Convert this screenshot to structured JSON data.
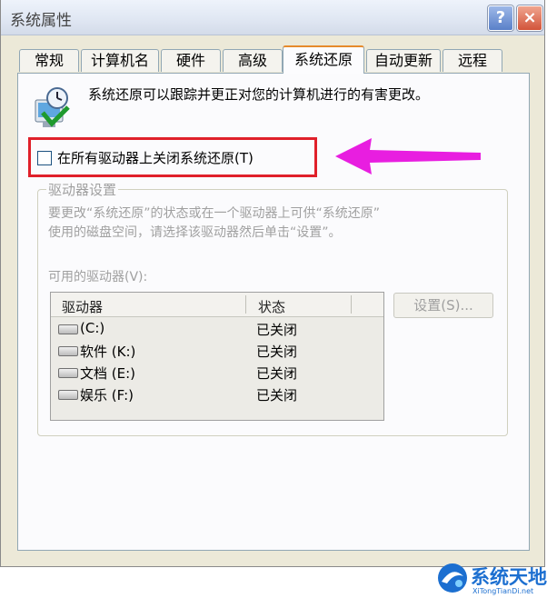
{
  "window": {
    "title": "系统属性",
    "help_glyph": "?",
    "close_glyph": "×"
  },
  "tabs": [
    {
      "label": "常规",
      "active": false
    },
    {
      "label": "计算机名",
      "active": false
    },
    {
      "label": "硬件",
      "active": false
    },
    {
      "label": "高级",
      "active": false
    },
    {
      "label": "系统还原",
      "active": true
    },
    {
      "label": "自动更新",
      "active": false
    },
    {
      "label": "远程",
      "active": false
    }
  ],
  "intro_text": "系统还原可以跟踪并更正对您的计算机进行的有害更改。",
  "disable_checkbox": {
    "label": "在所有驱动器上关闭系统还原(T)",
    "checked": false
  },
  "drive_settings": {
    "title": "驱动器设置",
    "description_line1": "要更改“系统还原”的状态或在一个驱动器上可供“系统还原”",
    "description_line2": "使用的磁盘空间，请选择该驱动器然后单击“设置”。",
    "available_label": "可用的驱动器(V):",
    "columns": {
      "drive": "驱动器",
      "status": "状态"
    },
    "drives": [
      {
        "name": "(C:)",
        "status": "已关闭"
      },
      {
        "name": "软件 (K:)",
        "status": "已关闭"
      },
      {
        "name": "文档 (E:)",
        "status": "已关闭"
      },
      {
        "name": "娱乐 (F:)",
        "status": "已关闭"
      }
    ],
    "settings_button": "设置(S)..."
  },
  "annotation": {
    "highlight_color": "#e0202a",
    "arrow_color": "#e81ee0"
  },
  "watermark": {
    "name": "系统天地",
    "url": "XiTongTianDi.net"
  }
}
